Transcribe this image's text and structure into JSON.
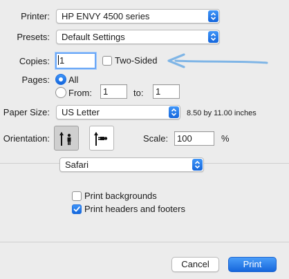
{
  "printer": {
    "label": "Printer:",
    "value": "HP ENVY 4500 series"
  },
  "presets": {
    "label": "Presets:",
    "value": "Default Settings"
  },
  "copies": {
    "label": "Copies:",
    "value": "1",
    "two_sided_label": "Two-Sided",
    "two_sided_checked": false
  },
  "pages": {
    "label": "Pages:",
    "all_label": "All",
    "from_label": "From:",
    "from_value": "1",
    "to_label": "to:",
    "to_value": "1",
    "selected": "All"
  },
  "paper": {
    "label": "Paper Size:",
    "value": "US Letter",
    "dimensions": "8.50 by 11.00 inches"
  },
  "orientation": {
    "label": "Orientation:",
    "selected": "portrait",
    "options": [
      "portrait",
      "landscape"
    ]
  },
  "scale": {
    "label": "Scale:",
    "value": "100",
    "unit": "%"
  },
  "app_section": {
    "value": "Safari"
  },
  "options": {
    "print_backgrounds": {
      "label": "Print backgrounds",
      "checked": false
    },
    "print_headers_footers": {
      "label": "Print headers and footers",
      "checked": true
    }
  },
  "buttons": {
    "cancel": "Cancel",
    "print": "Print"
  },
  "annotation": {
    "arrow_color": "#7fb5e6"
  },
  "colors": {
    "accent": "#1466dc",
    "background": "#ececec"
  }
}
